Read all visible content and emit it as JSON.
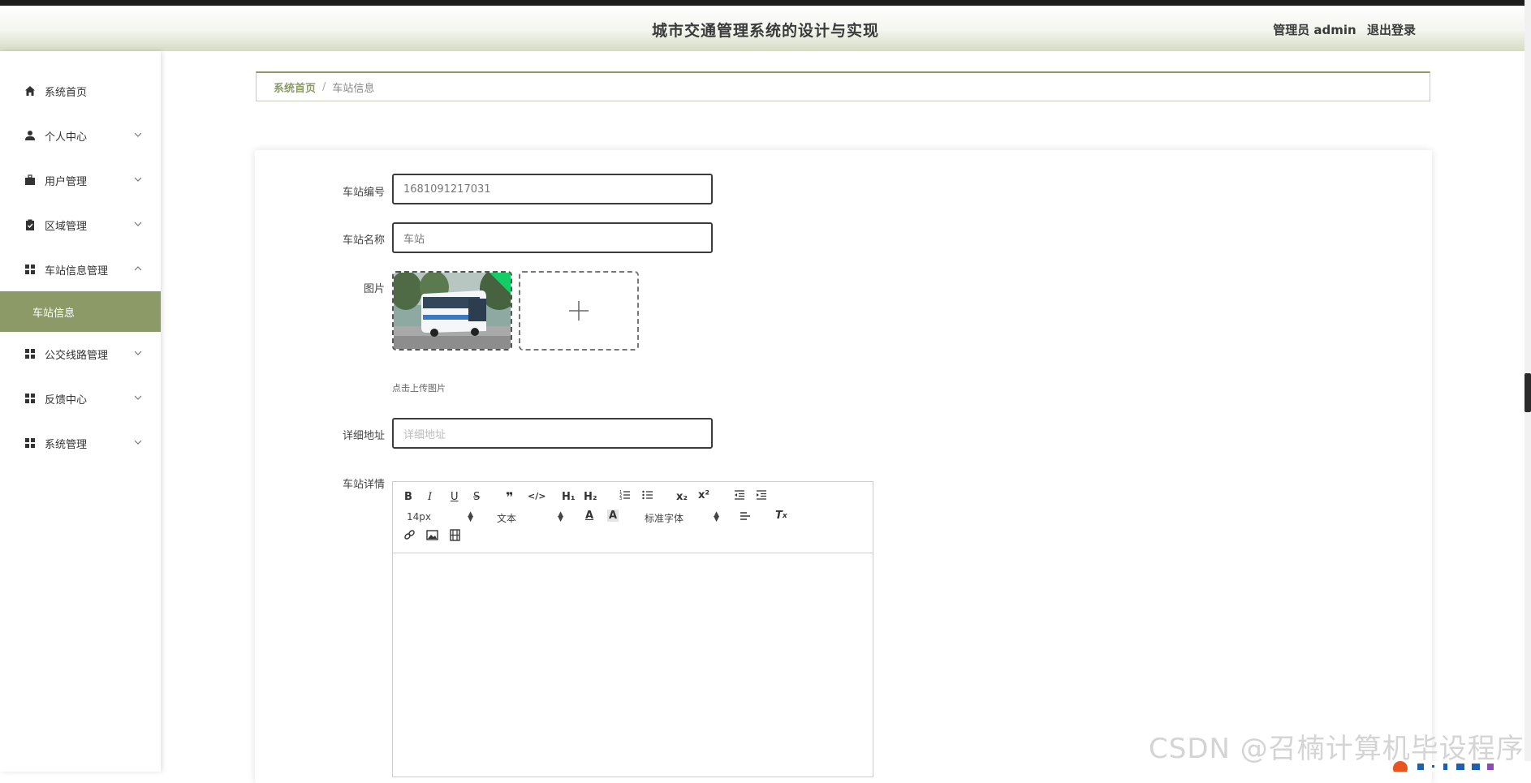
{
  "header": {
    "title": "城市交通管理系统的设计与实现",
    "user_label": "管理员 admin",
    "logout_label": "退出登录"
  },
  "sidebar": {
    "items": [
      {
        "label": "系统首页",
        "icon": "home-icon"
      },
      {
        "label": "个人中心",
        "icon": "person-icon"
      },
      {
        "label": "用户管理",
        "icon": "briefcase-icon"
      },
      {
        "label": "区域管理",
        "icon": "clipboard-icon"
      },
      {
        "label": "车站信息管理",
        "icon": "grid-icon"
      },
      {
        "label": "公交线路管理",
        "icon": "grid-icon"
      },
      {
        "label": "反馈中心",
        "icon": "grid-icon"
      },
      {
        "label": "系统管理",
        "icon": "grid-icon"
      }
    ],
    "active_submenu": "车站信息"
  },
  "breadcrumb": {
    "home": "系统首页",
    "separator": "/",
    "current": "车站信息"
  },
  "form": {
    "station_no_label": "车站编号",
    "station_no_value": "1681091217031",
    "station_name_label": "车站名称",
    "station_name_value": "车站",
    "image_label": "图片",
    "upload_hint": "点击上传图片",
    "address_label": "详细地址",
    "address_placeholder": "详细地址",
    "detail_label": "车站详情"
  },
  "editor": {
    "font_size": "14px",
    "text_style": "文本",
    "font_family": "标准字体"
  },
  "watermark": "CSDN @召楠计算机毕设程序",
  "colors": {
    "accent": "#8c9a68",
    "header_gradient_end": "#d5dcc4",
    "upload_corner": "#13ce66"
  }
}
